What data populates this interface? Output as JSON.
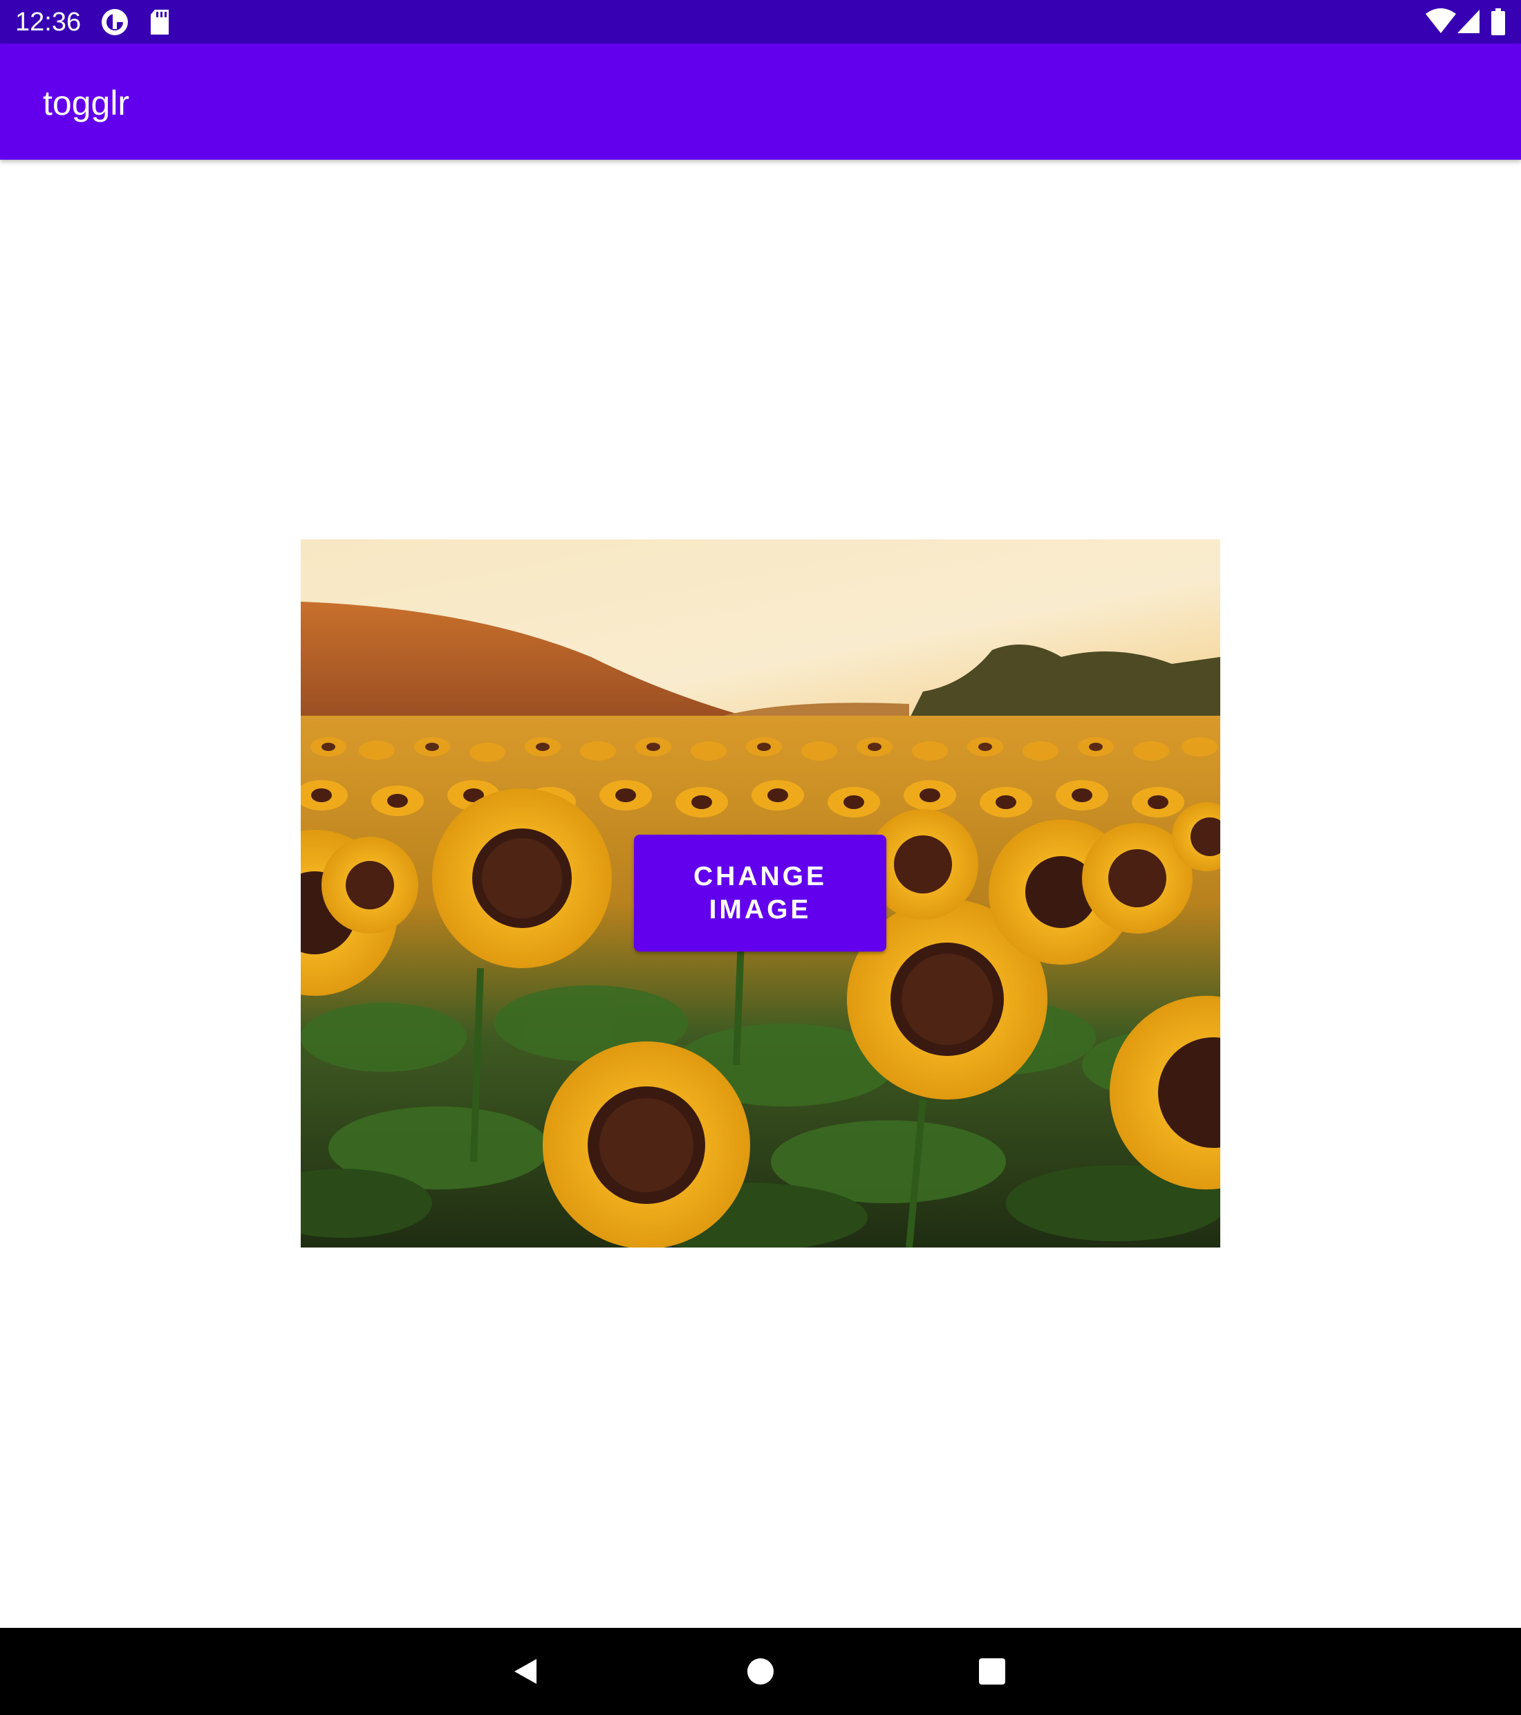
{
  "status_bar": {
    "time": "12:36",
    "left_icons": [
      "data-saver-icon",
      "sd-card-icon"
    ],
    "right_icons": [
      "wifi-icon",
      "cell-signal-icon",
      "battery-icon"
    ]
  },
  "app_bar": {
    "title": "togglr"
  },
  "main": {
    "image_icon": "sunflower-field-photo",
    "button_label": "CHANGE IMAGE"
  },
  "nav_bar": {
    "icons": [
      "back-icon",
      "home-icon",
      "recents-icon"
    ]
  },
  "colors": {
    "status_bar": "#3700b3",
    "primary": "#6200ee",
    "nav_bar": "#000000"
  }
}
